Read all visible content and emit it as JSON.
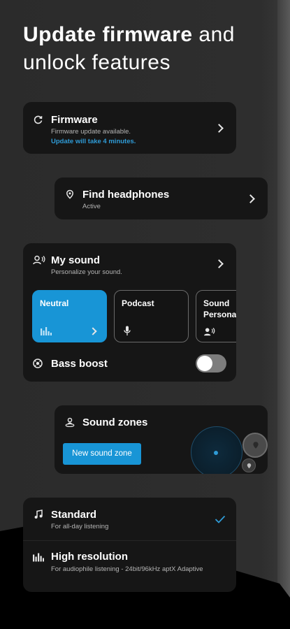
{
  "headline": {
    "bold": "Update firmware",
    "rest_line1": " and",
    "line2": "unlock features"
  },
  "firmware": {
    "title": "Firmware",
    "subtitle": "Firmware update available.",
    "note": "Update will take 4 minutes."
  },
  "find_headphones": {
    "title": "Find headphones",
    "status": "Active"
  },
  "my_sound": {
    "title": "My sound",
    "subtitle": "Personalize your sound.",
    "presets": [
      {
        "label": "Neutral",
        "icon": "equalizer-icon",
        "active": true
      },
      {
        "label": "Podcast",
        "icon": "microphone-icon",
        "active": false
      },
      {
        "label": "Sound Personal",
        "icon": "person-sound-icon",
        "active": false
      }
    ],
    "bass_boost": {
      "label": "Bass boost",
      "enabled": false
    }
  },
  "sound_zones": {
    "title": "Sound zones",
    "button": "New sound zone"
  },
  "quality": {
    "standard": {
      "title": "Standard",
      "subtitle": "For all-day listening",
      "selected": true
    },
    "high_resolution": {
      "title": "High resolution",
      "subtitle": "For audiophile listening - 24bit/96kHz aptX Adaptive",
      "selected": false
    }
  },
  "colors": {
    "accent": "#1895d6",
    "card": "#161616",
    "background": "#2b2b2b"
  }
}
